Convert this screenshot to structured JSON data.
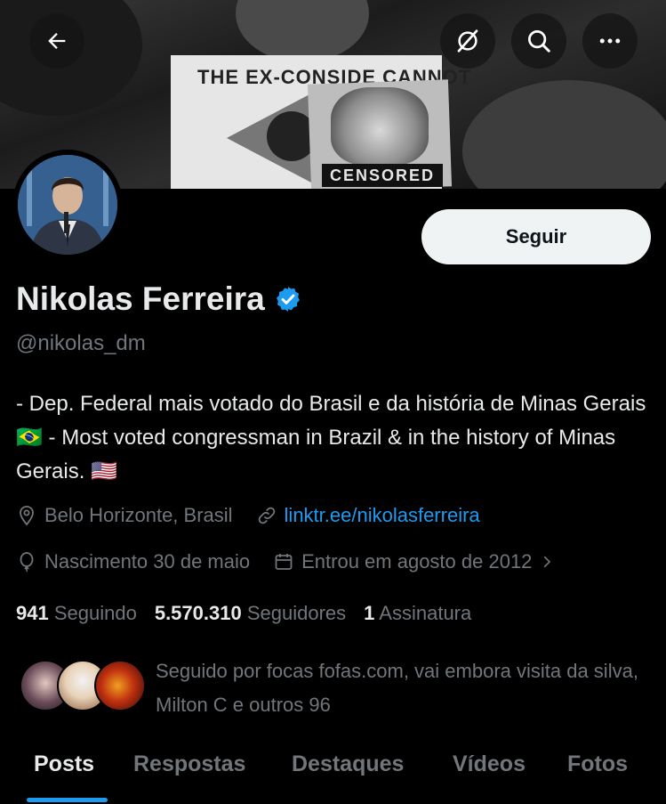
{
  "banner": {
    "sign_text": "THE EX-CONSIDE CANNOT",
    "censored_text": "CENSORED"
  },
  "header_buttons": [
    {
      "name": "back-arrow-icon"
    },
    {
      "name": "grok-icon"
    },
    {
      "name": "search-icon"
    },
    {
      "name": "more-icon"
    }
  ],
  "profile": {
    "follow_label": "Seguir",
    "name": "Nikolas Ferreira",
    "handle": "@nikolas_dm",
    "bio": "- Dep. Federal mais votado do Brasil e da história de Minas Gerais 🇧🇷 - Most voted congressman in Brazil & in the history of Minas Gerais. 🇺🇸",
    "location": "Belo Horizonte, Brasil",
    "website": "linktr.ee/nikolasferreira",
    "birthday": "Nascimento 30 de maio",
    "joined": "Entrou em agosto de 2012",
    "verified_color": "#1d9bf0"
  },
  "stats": {
    "following_count": "941",
    "following_label": "Seguindo",
    "followers_count": "5.570.310",
    "followers_label": "Seguidores",
    "subs_count": "1",
    "subs_label": "Assinatura"
  },
  "known_followers": {
    "text": "Seguido por focas fofas.com, vai embora visita da silva, Milton C e outros 96"
  },
  "tabs": [
    {
      "label": "Posts",
      "active": true
    },
    {
      "label": "Respostas",
      "active": false
    },
    {
      "label": "Destaques",
      "active": false
    },
    {
      "label": "Vídeos",
      "active": false
    },
    {
      "label": "Fotos",
      "active": false
    }
  ]
}
